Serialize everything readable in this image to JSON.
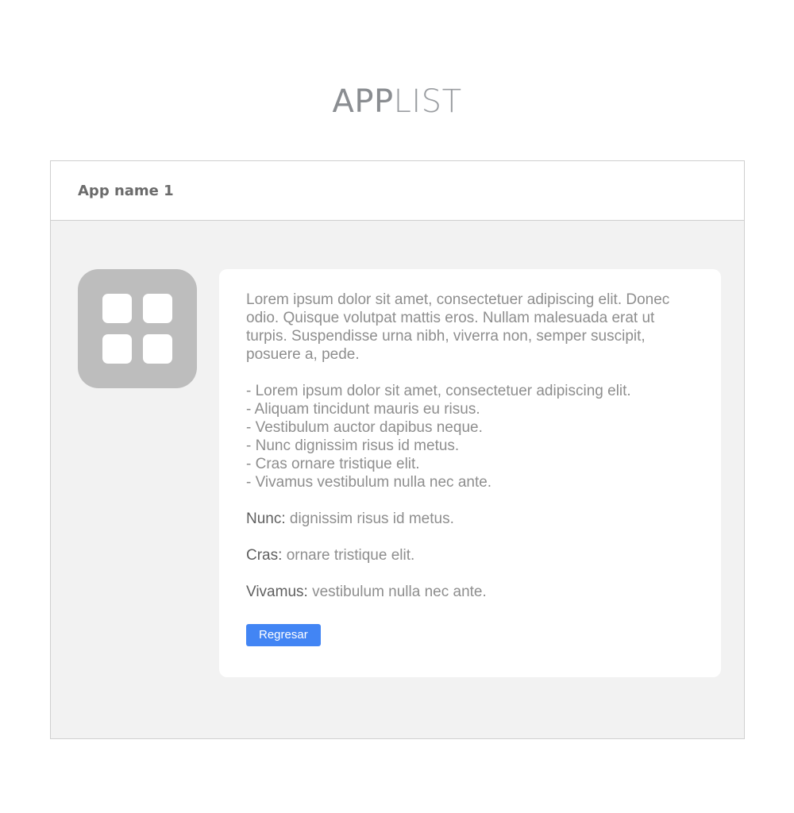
{
  "header": {
    "logo_part1": "APP",
    "logo_part2": "LIST"
  },
  "app": {
    "name": "App name 1",
    "icon": "grid-icon",
    "description": "Lorem ipsum dolor sit amet, consectetuer adipiscing elit. Donec odio. Quisque volutpat mattis eros. Nullam malesuada erat ut turpis. Suspendisse urna nibh, viverra non, semper suscipit, posuere a, pede.",
    "features": [
      "- Lorem ipsum dolor sit amet, consectetuer adipiscing elit.",
      "- Aliquam tincidunt mauris eu risus.",
      "- Vestibulum auctor dapibus neque.",
      "- Nunc dignissim risus id metus.",
      "- Cras ornare tristique elit.",
      "- Vivamus vestibulum nulla nec ante."
    ],
    "details": [
      {
        "key": "Nunc:",
        "value": "dignissim risus id metus."
      },
      {
        "key": "Cras:",
        "value": "ornare tristique elit."
      },
      {
        "key": "Vivamus:",
        "value": "vestibulum nulla nec ante."
      }
    ],
    "back_button_label": "Regresar"
  },
  "colors": {
    "accent": "#4285f4",
    "panel_bg": "#f2f2f2",
    "icon_bg": "#bdbdbd"
  }
}
